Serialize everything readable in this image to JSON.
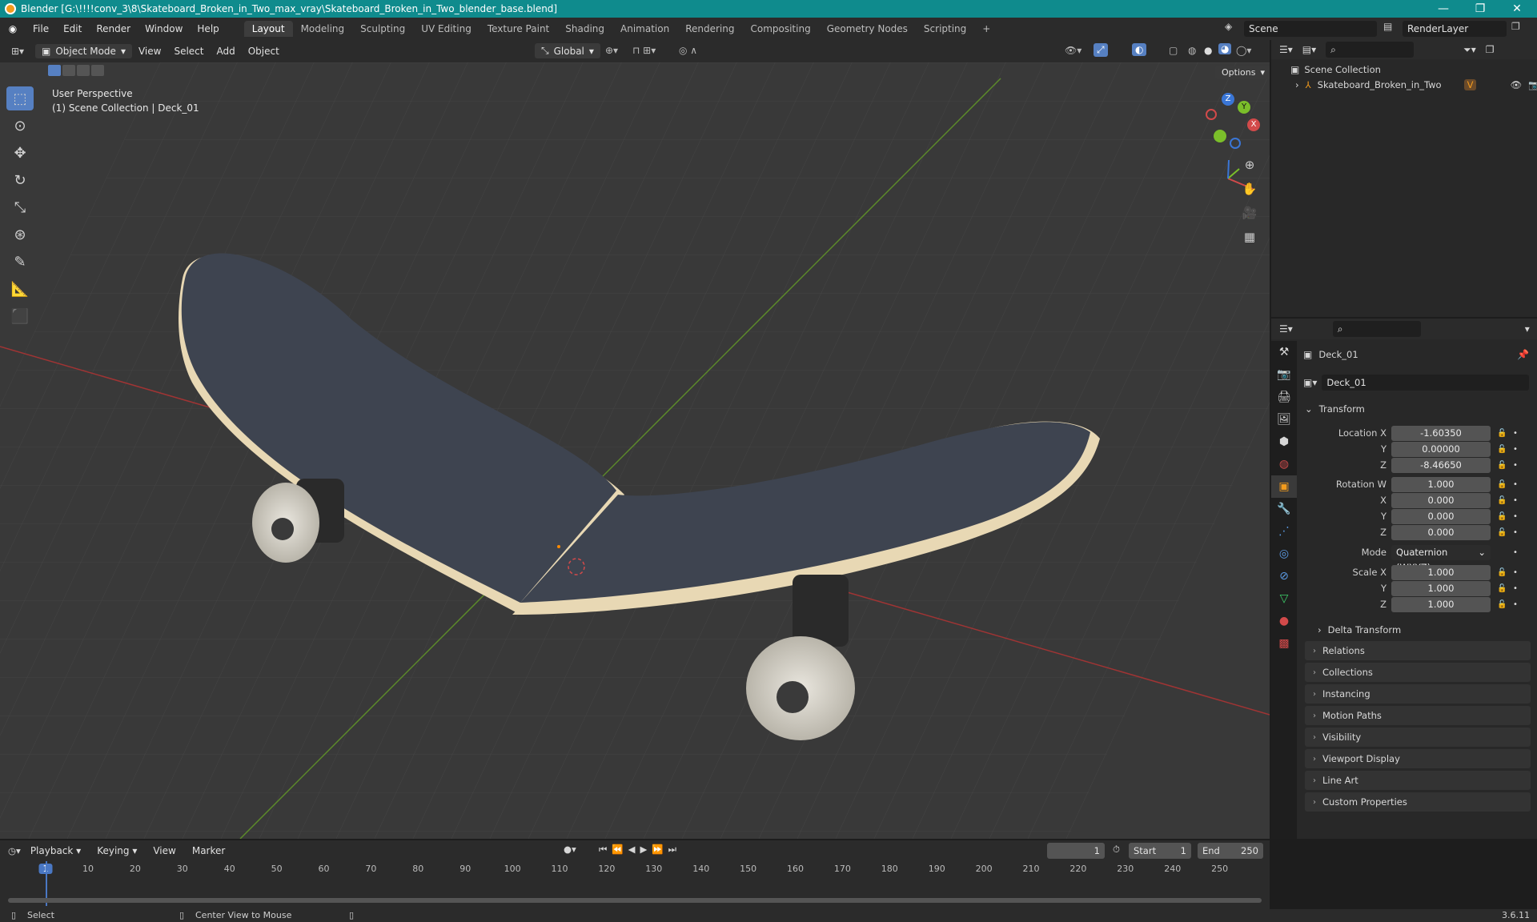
{
  "titlebar": {
    "title": "Blender [G:\\!!!!conv_3\\8\\Skateboard_Broken_in_Two_max_vray\\Skateboard_Broken_in_Two_blender_base.blend]",
    "min": "—",
    "max": "❐",
    "close": "✕"
  },
  "menu": {
    "file": "File",
    "edit": "Edit",
    "render": "Render",
    "window": "Window",
    "help": "Help"
  },
  "workspaces": [
    "Layout",
    "Modeling",
    "Sculpting",
    "UV Editing",
    "Texture Paint",
    "Shading",
    "Animation",
    "Rendering",
    "Compositing",
    "Geometry Nodes",
    "Scripting"
  ],
  "scene": {
    "scene_name": "Scene",
    "render_layer": "RenderLayer"
  },
  "viewport_header": {
    "mode": "Object Mode",
    "view": "View",
    "select": "Select",
    "add": "Add",
    "object": "Object",
    "orientation": "Global",
    "options": "Options"
  },
  "viewport": {
    "perspective": "User Perspective",
    "collection_info": "(1) Scene Collection | Deck_01"
  },
  "gizmo": {
    "x": "X",
    "y": "Y",
    "z": "Z"
  },
  "outliner": {
    "root": "Scene Collection",
    "item": "Skateboard_Broken_in_Two"
  },
  "properties": {
    "object_name": "Deck_01",
    "object_field": "Deck_01",
    "transform": "Transform",
    "location_x_label": "Location X",
    "location_x": "-1.60350",
    "location_y_label": "Y",
    "location_y": "0.00000",
    "location_z_label": "Z",
    "location_z": "-8.46650",
    "rotation_w_label": "Rotation W",
    "rotation_w": "1.000",
    "rotation_x_label": "X",
    "rotation_x": "0.000",
    "rotation_y_label": "Y",
    "rotation_y": "0.000",
    "rotation_z_label": "Z",
    "rotation_z": "0.000",
    "mode_label": "Mode",
    "mode": "Quaternion (WXYZ)",
    "scale_x_label": "Scale X",
    "scale_x": "1.000",
    "scale_y_label": "Y",
    "scale_y": "1.000",
    "scale_z_label": "Z",
    "scale_z": "1.000",
    "delta_transform": "Delta Transform",
    "panels": [
      "Relations",
      "Collections",
      "Instancing",
      "Motion Paths",
      "Visibility",
      "Viewport Display",
      "Line Art",
      "Custom Properties"
    ]
  },
  "timeline": {
    "playback": "Playback",
    "keying": "Keying",
    "view": "View",
    "marker": "Marker",
    "current_frame": "1",
    "start_label": "Start",
    "start": "1",
    "end_label": "End",
    "end": "250",
    "ruler": [
      "1",
      "10",
      "20",
      "30",
      "40",
      "50",
      "60",
      "70",
      "80",
      "90",
      "100",
      "110",
      "120",
      "130",
      "140",
      "150",
      "160",
      "170",
      "180",
      "190",
      "200",
      "210",
      "220",
      "230",
      "240",
      "250"
    ]
  },
  "status": {
    "select": "Select",
    "center_view": "Center View to Mouse",
    "version": "3.6.11"
  }
}
